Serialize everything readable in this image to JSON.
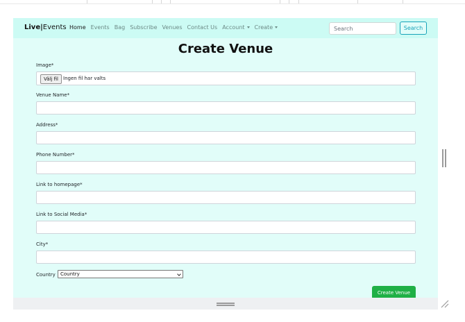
{
  "navbar": {
    "brand_live": "Live",
    "brand_separator": "|",
    "brand_events": "Events",
    "links": [
      {
        "label": "Home",
        "active": true
      },
      {
        "label": "Events",
        "active": false
      },
      {
        "label": "Bag",
        "active": false
      },
      {
        "label": "Subscribe",
        "active": false
      },
      {
        "label": "Venues",
        "active": false
      },
      {
        "label": "Contact Us",
        "active": false
      },
      {
        "label": "Account",
        "active": false,
        "dropdown": true
      },
      {
        "label": "Create",
        "active": false,
        "dropdown": true
      }
    ],
    "search_placeholder": "Search",
    "search_button": "Search"
  },
  "form": {
    "title": "Create Venue",
    "image_label": "Image*",
    "file_button": "Välj fil",
    "file_status": "Ingen fil har valts",
    "fields": [
      {
        "label": "Venue Name*",
        "value": ""
      },
      {
        "label": "Address*",
        "value": ""
      },
      {
        "label": "Phone Number*",
        "value": ""
      },
      {
        "label": "Link to homepage*",
        "value": ""
      },
      {
        "label": "Link to Social Media*",
        "value": ""
      },
      {
        "label": "City*",
        "value": ""
      }
    ],
    "country_label": "Country",
    "country_selected": "Country",
    "submit_label": "Create Venue"
  },
  "colors": {
    "navbar_bg": "#ccfbf4",
    "page_bg": "#e1fdf9",
    "search_accent": "#17a2b8",
    "submit_bg": "#1fb046"
  }
}
